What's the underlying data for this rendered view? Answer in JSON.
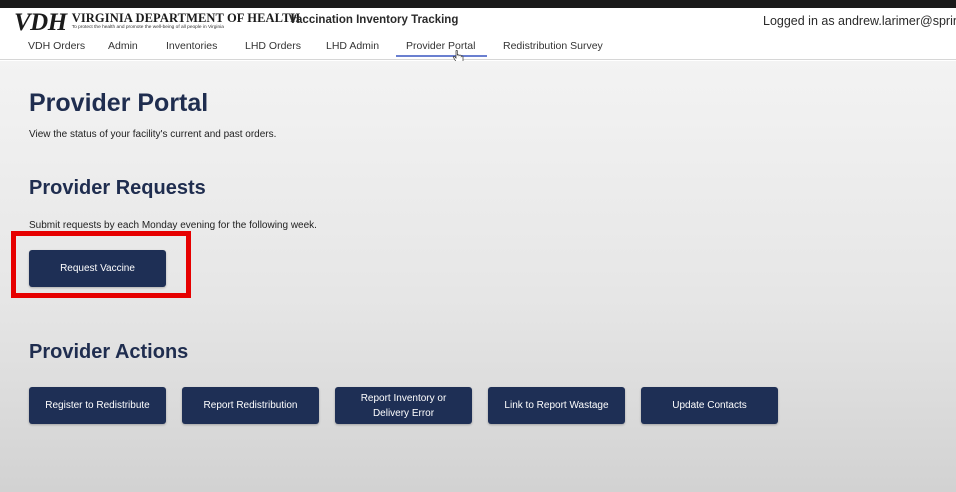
{
  "header": {
    "logo_mark": "VDH",
    "logo_title": "VIRGINIA DEPARTMENT OF HEALTH",
    "logo_tagline": "To protect the health and promote the well-being of all people in Virginia",
    "app_name": "Vaccination Inventory Tracking",
    "user_text": "Logged in as andrew.larimer@springs"
  },
  "nav": {
    "items": [
      {
        "label": "VDH Orders"
      },
      {
        "label": "Admin"
      },
      {
        "label": "Inventories"
      },
      {
        "label": "LHD Orders"
      },
      {
        "label": "LHD Admin"
      },
      {
        "label": "Provider Portal",
        "active": true
      },
      {
        "label": "Redistribution Survey"
      }
    ]
  },
  "page": {
    "title": "Provider Portal",
    "subtitle": "View the status of your facility's current and past orders."
  },
  "requests": {
    "title": "Provider Requests",
    "note": "Submit requests by each Monday evening for the following week.",
    "button_label": "Request Vaccine"
  },
  "actions": {
    "title": "Provider Actions",
    "buttons": [
      {
        "label": "Register to Redistribute"
      },
      {
        "label": "Report Redistribution"
      },
      {
        "label": "Report Inventory or Delivery Error"
      },
      {
        "label": "Link to Report Wastage"
      },
      {
        "label": "Update Contacts"
      }
    ]
  },
  "colors": {
    "brand_navy": "#1e2f55",
    "heading": "#1f2d4f",
    "annotation_red": "#e60000",
    "active_tab_underline": "#6a7fd0"
  },
  "icons": {
    "cursor": "hand-pointer-icon"
  }
}
